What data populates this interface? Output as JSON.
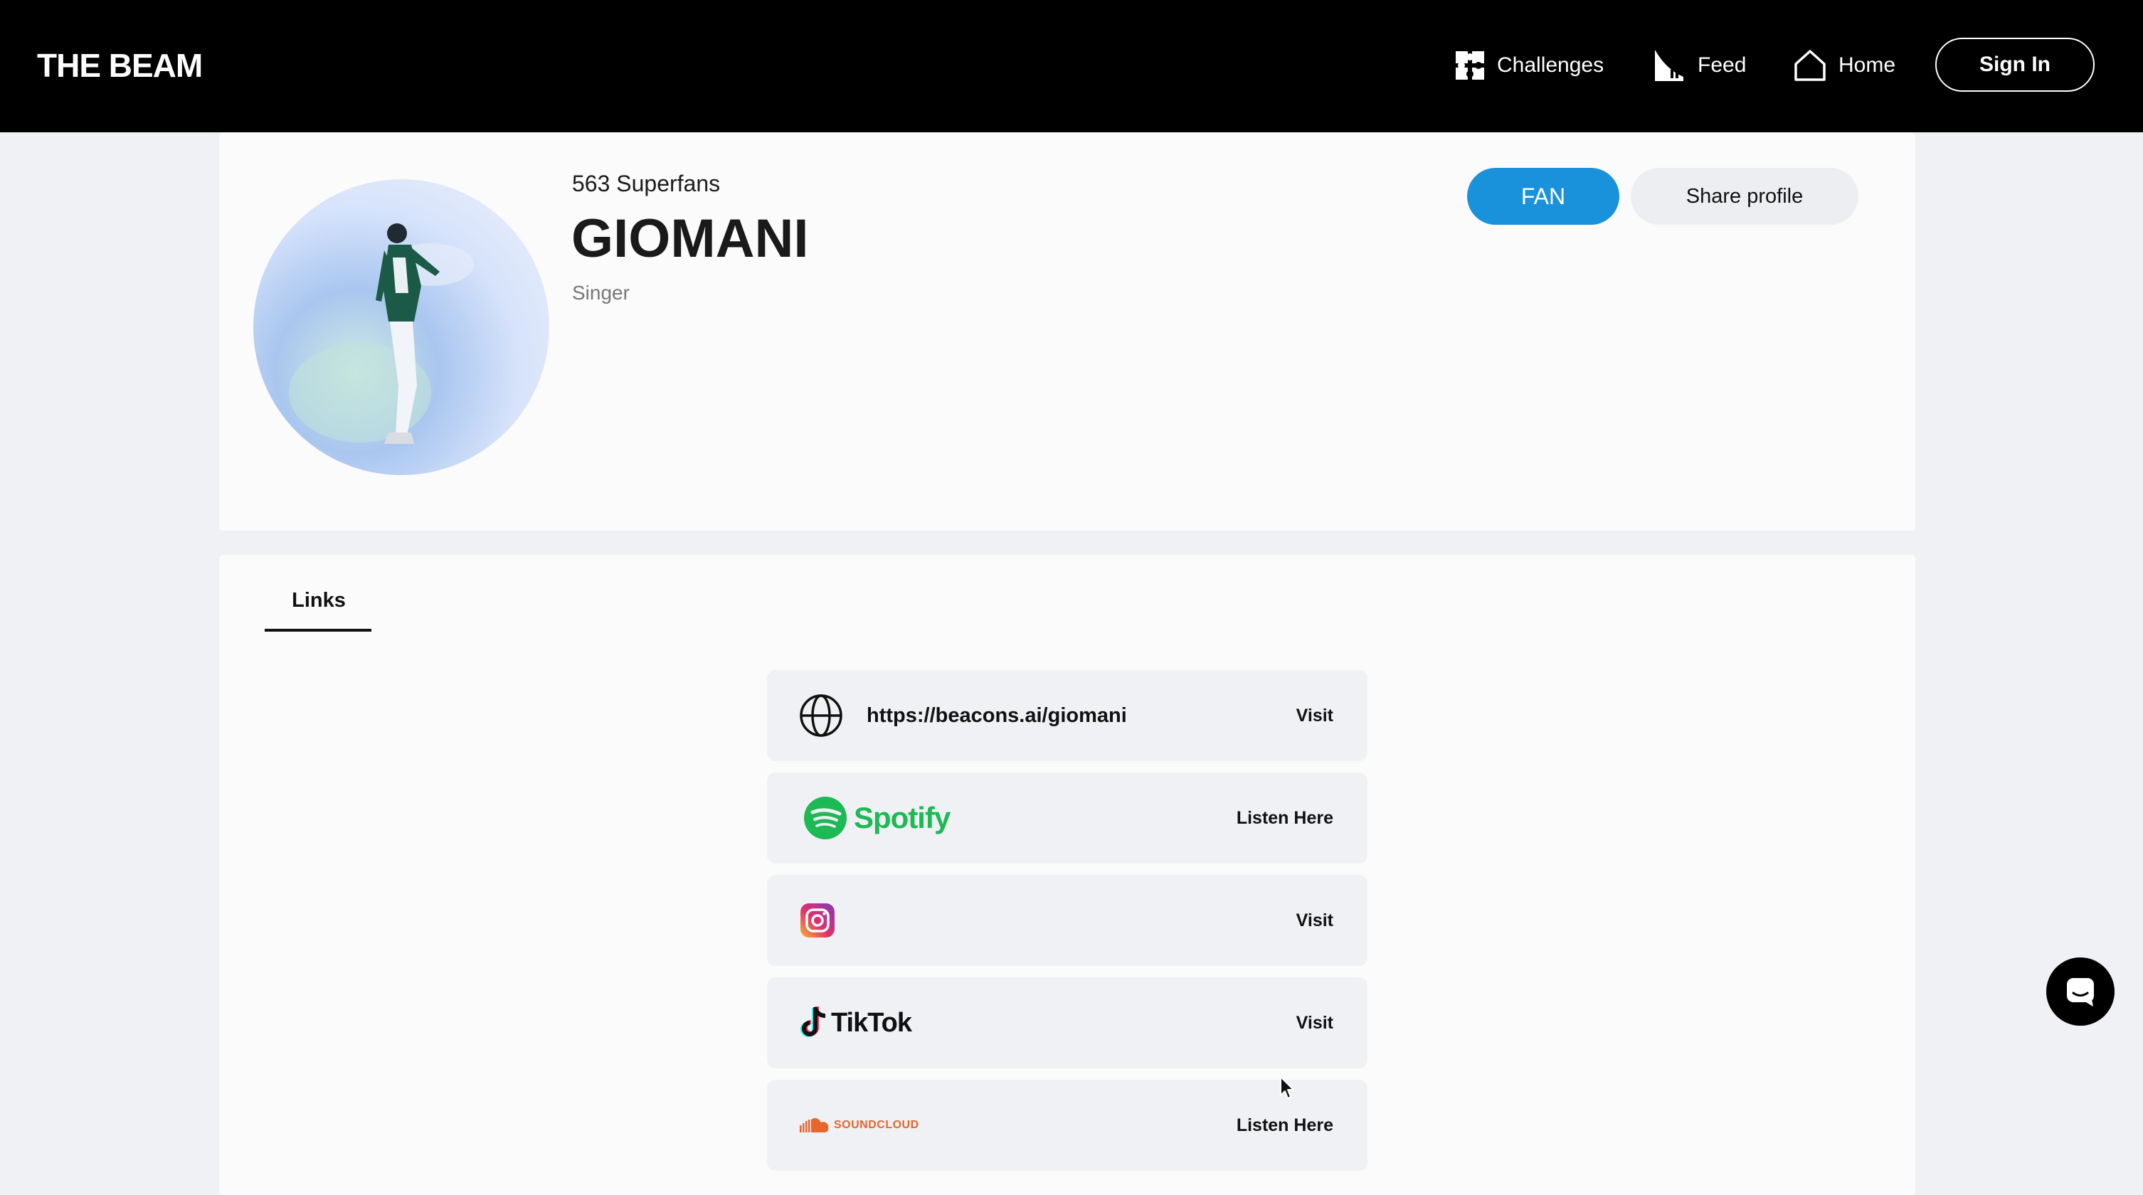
{
  "header": {
    "logo": "THE BEAM",
    "nav": [
      {
        "label": "Challenges",
        "icon": "puzzle-icon"
      },
      {
        "label": "Feed",
        "icon": "feed-icon"
      },
      {
        "label": "Home",
        "icon": "home-icon"
      }
    ],
    "signin_label": "Sign In"
  },
  "profile": {
    "superfans": "563 Superfans",
    "name": "GIOMANI",
    "role": "Singer",
    "fan_label": "FAN",
    "share_label": "Share profile"
  },
  "tabs": [
    {
      "label": "Links",
      "active": true
    }
  ],
  "links": [
    {
      "icon": "globe-icon",
      "text": "https://beacons.ai/giomani",
      "action": "Visit"
    },
    {
      "icon": "spotify-icon",
      "brand": "Spotify",
      "action": "Listen Here"
    },
    {
      "icon": "instagram-icon",
      "action": "Visit"
    },
    {
      "icon": "tiktok-icon",
      "brand": "TikTok",
      "action": "Visit"
    },
    {
      "icon": "soundcloud-icon",
      "brand": "SOUNDCLOUD",
      "action": "Listen Here"
    }
  ],
  "colors": {
    "header_bg": "#000000",
    "fan_button": "#1a91db",
    "spotify_green": "#1db954",
    "soundcloud_orange": "#e8652c",
    "page_bg": "#eff1f5"
  }
}
